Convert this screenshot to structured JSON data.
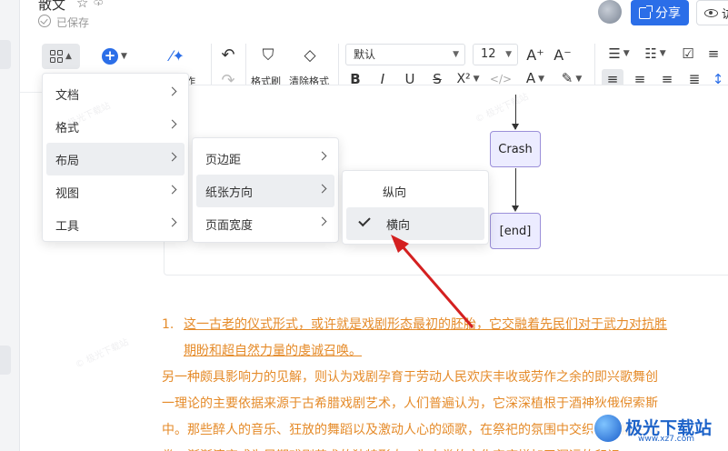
{
  "app": {
    "doc_title": "散文",
    "save_status": "已保存",
    "share_label": "分享",
    "view_label": "访"
  },
  "toolbar": {
    "insert_label": "作",
    "format_painter": "格式刷",
    "clear_format": "清除格式",
    "font_name": "默认",
    "font_size": "12",
    "font_grow": "A⁺",
    "font_shrink": "A⁻",
    "bold": "B",
    "italic": "I",
    "underline": "U",
    "strike": "S",
    "superscript": "X²",
    "code": "</>",
    "font_color": "A"
  },
  "menu_main": {
    "items": [
      {
        "label": "文档"
      },
      {
        "label": "格式"
      },
      {
        "label": "布局"
      },
      {
        "label": "视图"
      },
      {
        "label": "工具"
      }
    ]
  },
  "menu_layout": {
    "items": [
      {
        "label": "页边距"
      },
      {
        "label": "纸张方向"
      },
      {
        "label": "页面宽度"
      }
    ]
  },
  "menu_orientation": {
    "items": [
      {
        "label": "纵向"
      },
      {
        "label": "横向"
      }
    ],
    "checked": "横向"
  },
  "diagram": {
    "nodes": [
      "Crash",
      "[end]"
    ]
  },
  "content": {
    "p1_num": "1.",
    "p1_line1": "这一古老的仪式形式，或许就是戏剧形态最初的胚胎，它交融着先民们对于武力对抗胜",
    "p1_line2": "期盼和超自然力量的虔诚召唤。",
    "p2_line1": "另一种颇具影响力的见解，则认为戏剧孕育于劳动人民欢庆丰收或劳作之余的即兴歌舞创",
    "p2_line2": "一理论的主要依据来源于古希腊戏剧艺术，人们普遍认为，它深深植根于酒神狄俄倪索斯",
    "p2_line3": "中。那些醉人的音乐、狂放的舞蹈以及激动人心的颂歌，在祭祀的氛围中交织成一幅生动",
    "p2_line4": "卷，渐渐演变成为早期戏剧艺术的独特形态，为人类的文化宝库增加了深远的印记"
  },
  "watermark": {
    "logo_text": "极光下载站",
    "logo_sub": "www.xz7.com"
  }
}
